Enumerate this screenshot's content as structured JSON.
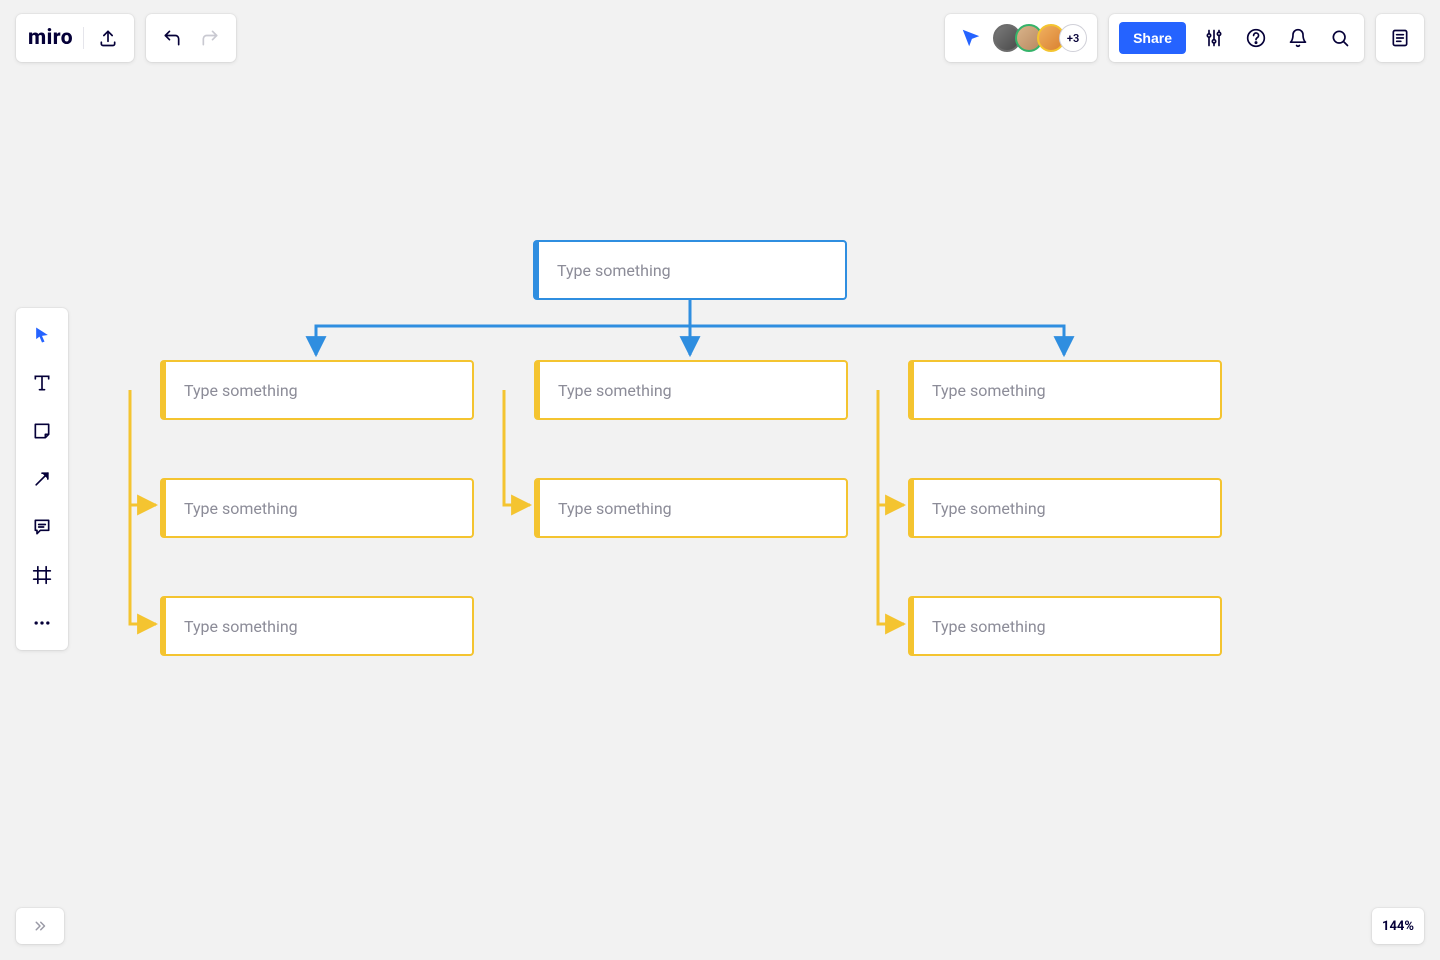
{
  "app": {
    "logo_text": "miro"
  },
  "collaborators": {
    "overflow_label": "+3"
  },
  "header": {
    "share_label": "Share"
  },
  "zoom": {
    "label": "144%"
  },
  "colors": {
    "accent_blue": "#2563ff",
    "connector_blue": "#2f8ee0",
    "connector_yellow": "#f4c430"
  },
  "canvas": {
    "root": {
      "placeholder": "Type something"
    },
    "col1_a": {
      "placeholder": "Type something"
    },
    "col1_b": {
      "placeholder": "Type something"
    },
    "col1_c": {
      "placeholder": "Type something"
    },
    "col2_a": {
      "placeholder": "Type something"
    },
    "col2_b": {
      "placeholder": "Type something"
    },
    "col3_a": {
      "placeholder": "Type something"
    },
    "col3_b": {
      "placeholder": "Type something"
    },
    "col3_c": {
      "placeholder": "Type something"
    }
  }
}
